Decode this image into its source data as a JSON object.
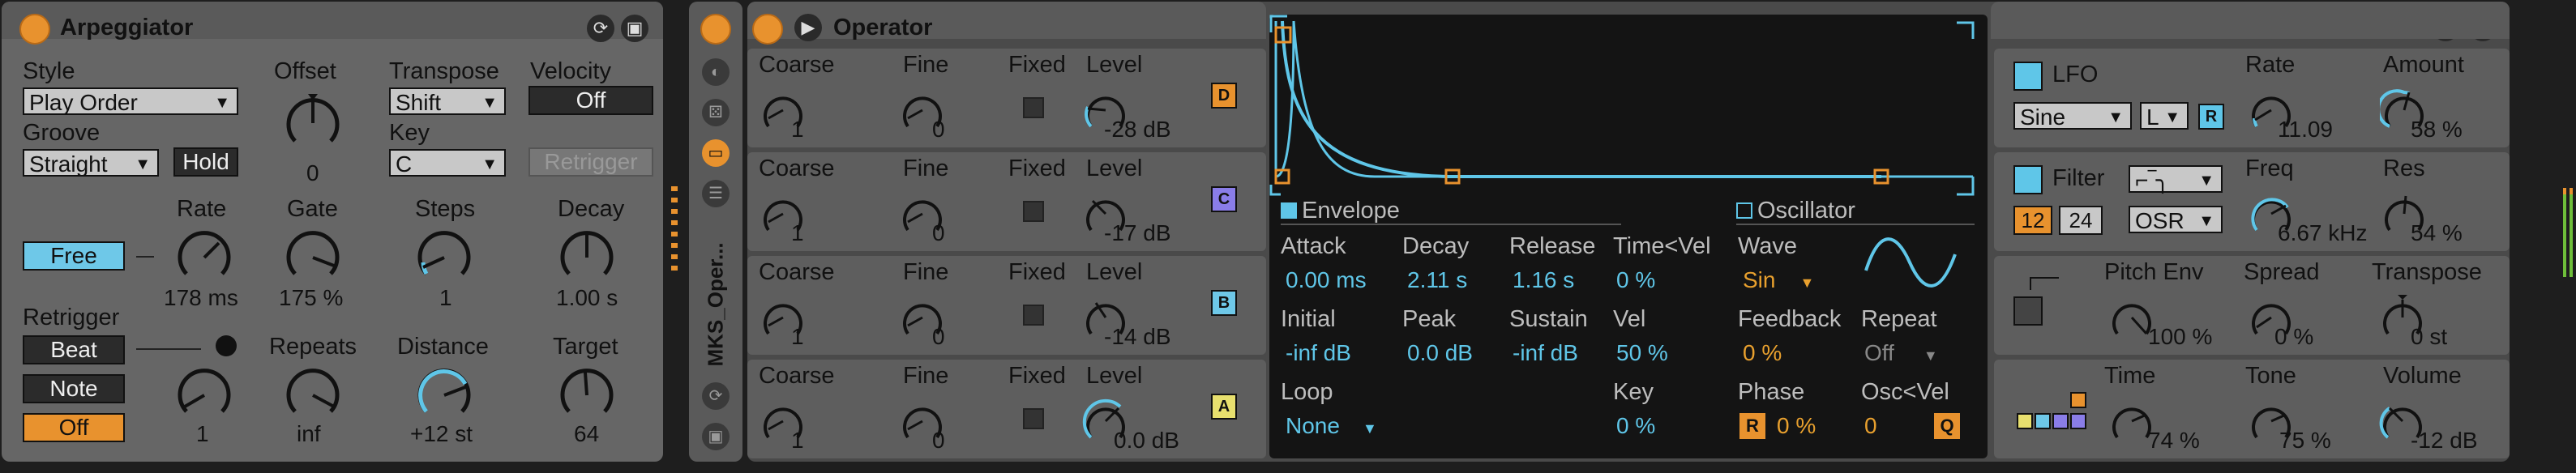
{
  "arp": {
    "title": "Arpeggiator",
    "style_label": "Style",
    "style_value": "Play Order",
    "groove_label": "Groove",
    "groove_value": "Straight",
    "hold_label": "Hold",
    "offset_label": "Offset",
    "offset_value": "0",
    "transpose_label": "Transpose",
    "transpose_value": "Shift",
    "key_label": "Key",
    "key_value": "C",
    "velocity_label": "Velocity",
    "velocity_value": "Off",
    "retrigger_btn": "Retrigger",
    "free_label": "Free",
    "rate_label": "Rate",
    "rate_value": "178 ms",
    "gate_label": "Gate",
    "gate_value": "175 %",
    "steps_label": "Steps",
    "steps_value": "1",
    "decay_label": "Decay",
    "decay_value": "1.00 s",
    "retrigger_label": "Retrigger",
    "beat_label": "Beat",
    "note_label": "Note",
    "off_label": "Off",
    "retrig_knob_value": "1",
    "repeats_label": "Repeats",
    "repeats_value": "inf",
    "distance_label": "Distance",
    "distance_value": "+12 st",
    "target_label": "Target",
    "target_value": "64"
  },
  "rack": {
    "name": "MKS_Oper..."
  },
  "operator": {
    "title": "Operator",
    "oscillators": [
      {
        "coarse_label": "Coarse",
        "coarse": "1",
        "fine_label": "Fine",
        "fine": "0",
        "fixed_label": "Fixed",
        "level_label": "Level",
        "level": "-28 dB",
        "tag": "D",
        "tag_color": "#e8922e"
      },
      {
        "coarse_label": "Coarse",
        "coarse": "1",
        "fine_label": "Fine",
        "fine": "0",
        "fixed_label": "Fixed",
        "level_label": "Level",
        "level": "-17 dB",
        "tag": "C",
        "tag_color": "#8a7de8"
      },
      {
        "coarse_label": "Coarse",
        "coarse": "1",
        "fine_label": "Fine",
        "fine": "0",
        "fixed_label": "Fixed",
        "level_label": "Level",
        "level": "-14 dB",
        "tag": "B",
        "tag_color": "#6ec8e8"
      },
      {
        "coarse_label": "Coarse",
        "coarse": "1",
        "fine_label": "Fine",
        "fine": "0",
        "fixed_label": "Fixed",
        "level_label": "Level",
        "level": "0.0 dB",
        "tag": "A",
        "tag_color": "#e8e06e"
      }
    ],
    "envelope": {
      "title": "Envelope",
      "attack_label": "Attack",
      "attack": "0.00 ms",
      "decay_label": "Decay",
      "decay": "2.11 s",
      "release_label": "Release",
      "release": "1.16 s",
      "timevel_label": "Time<Vel",
      "timevel": "0 %",
      "initial_label": "Initial",
      "initial": "-inf dB",
      "peak_label": "Peak",
      "peak": "0.0 dB",
      "sustain_label": "Sustain",
      "sustain": "-inf dB",
      "vel_label": "Vel",
      "vel": "50 %",
      "loop_label": "Loop",
      "loop": "None",
      "key_label": "Key",
      "key": "0 %"
    },
    "oscillator": {
      "title": "Oscillator",
      "wave_label": "Wave",
      "wave": "Sin",
      "feedback_label": "Feedback",
      "feedback": "0 %",
      "repeat_label": "Repeat",
      "repeat": "Off",
      "phase_label": "Phase",
      "phase_r": "R",
      "phase": "0 %",
      "oscvel_label": "Osc<Vel",
      "oscvel": "0",
      "oscvel_q": "Q"
    },
    "lfo": {
      "title": "LFO",
      "wave": "Sine",
      "mode": "L",
      "r": "R",
      "rate_label": "Rate",
      "rate": "11.09",
      "amount_label": "Amount",
      "amount": "58 %"
    },
    "filter": {
      "title": "Filter",
      "slope_12": "12",
      "slope_24": "24",
      "osr": "OSR",
      "freq_label": "Freq",
      "freq": "6.67 kHz",
      "res_label": "Res",
      "res": "54 %"
    },
    "pitch": {
      "pitch_env_label": "Pitch Env",
      "pitch_env": "100 %",
      "spread_label": "Spread",
      "spread": "0 %",
      "transpose_label": "Transpose",
      "transpose": "0 st"
    },
    "global": {
      "time_label": "Time",
      "time": "74 %",
      "tone_label": "Tone",
      "tone": "75 %",
      "volume_label": "Volume",
      "volume": "-12 dB"
    }
  }
}
